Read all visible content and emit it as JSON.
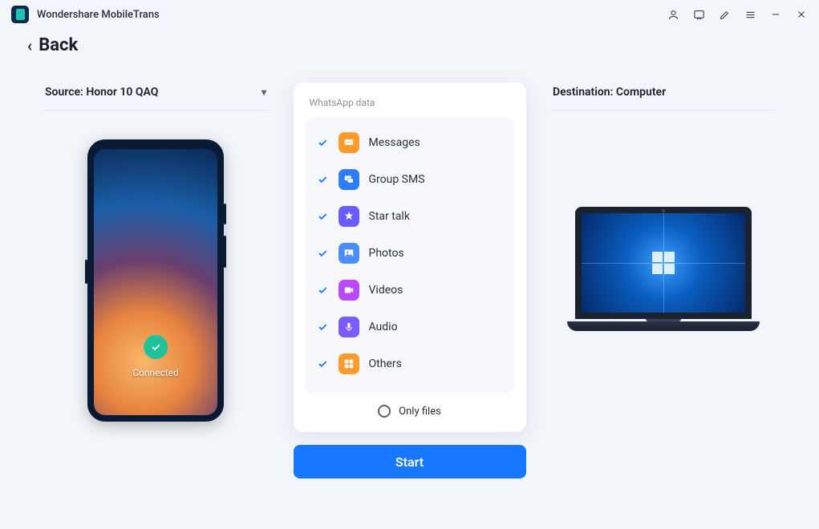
{
  "app": {
    "title": "Wondershare MobileTrans"
  },
  "back": {
    "label": "Back"
  },
  "source": {
    "label": "Source: Honor 10 QAQ",
    "status": "Connected"
  },
  "destination": {
    "label": "Destination: Computer"
  },
  "panel": {
    "title": "WhatsApp data",
    "items": [
      {
        "label": "Messages",
        "checked": true,
        "icon": "messages"
      },
      {
        "label": "Group SMS",
        "checked": true,
        "icon": "group"
      },
      {
        "label": "Star talk",
        "checked": true,
        "icon": "star"
      },
      {
        "label": "Photos",
        "checked": true,
        "icon": "photos"
      },
      {
        "label": "Videos",
        "checked": true,
        "icon": "videos"
      },
      {
        "label": "Audio",
        "checked": true,
        "icon": "audio"
      },
      {
        "label": "Others",
        "checked": true,
        "icon": "others"
      }
    ],
    "only_files": "Only files"
  },
  "actions": {
    "start": "Start"
  }
}
